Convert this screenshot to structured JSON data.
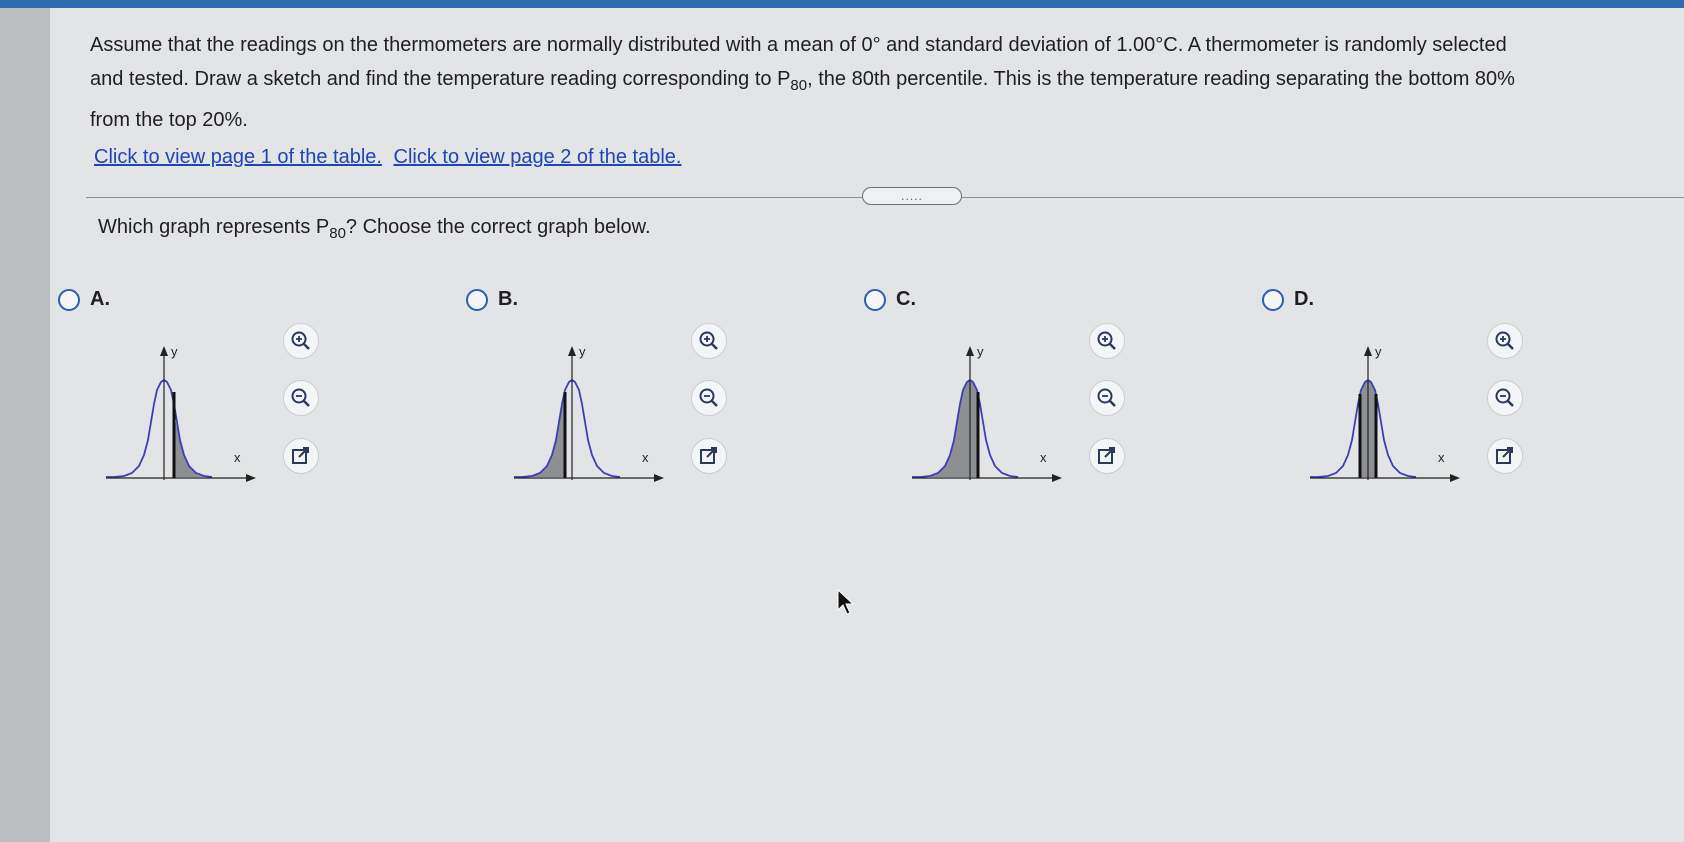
{
  "question": {
    "line1": "Assume that the readings on the thermometers are normally distributed with a mean of 0° and standard deviation of 1.00°C. A thermometer is randomly selected",
    "line2_a": "and tested. Draw a sketch and find the temperature reading corresponding to P",
    "line2_sub": "80",
    "line2_b": ", the 80th percentile. This is the temperature reading separating the bottom 80%",
    "line3": "from the top 20%."
  },
  "links": {
    "page1": "Click to view page 1 of the table.",
    "page2": "Click to view page 2 of the table."
  },
  "divider_handle": ".....",
  "prompt": {
    "text_a": "Which graph represents P",
    "sub": "80",
    "text_b": "? Choose the correct graph below."
  },
  "options": [
    {
      "letter": "A.",
      "shading": "right tail beyond vertical line",
      "selected": false
    },
    {
      "letter": "B.",
      "shading": "left of vertical line",
      "selected": false
    },
    {
      "letter": "C.",
      "shading": "left of vertical line",
      "selected": false
    },
    {
      "letter": "D.",
      "shading": "between two vertical lines",
      "selected": false
    }
  ],
  "axis_labels": {
    "y": "y",
    "x": "x"
  },
  "icons": {
    "zoom_in": "zoom-in-icon",
    "zoom_out": "zoom-out-icon",
    "popout": "popout-icon"
  },
  "colors": {
    "topbar": "#2d6cae",
    "link": "#1f45b8",
    "radio": "#2b5fb4",
    "curve": "#3a3fb8",
    "shade": "#8d8f93"
  }
}
